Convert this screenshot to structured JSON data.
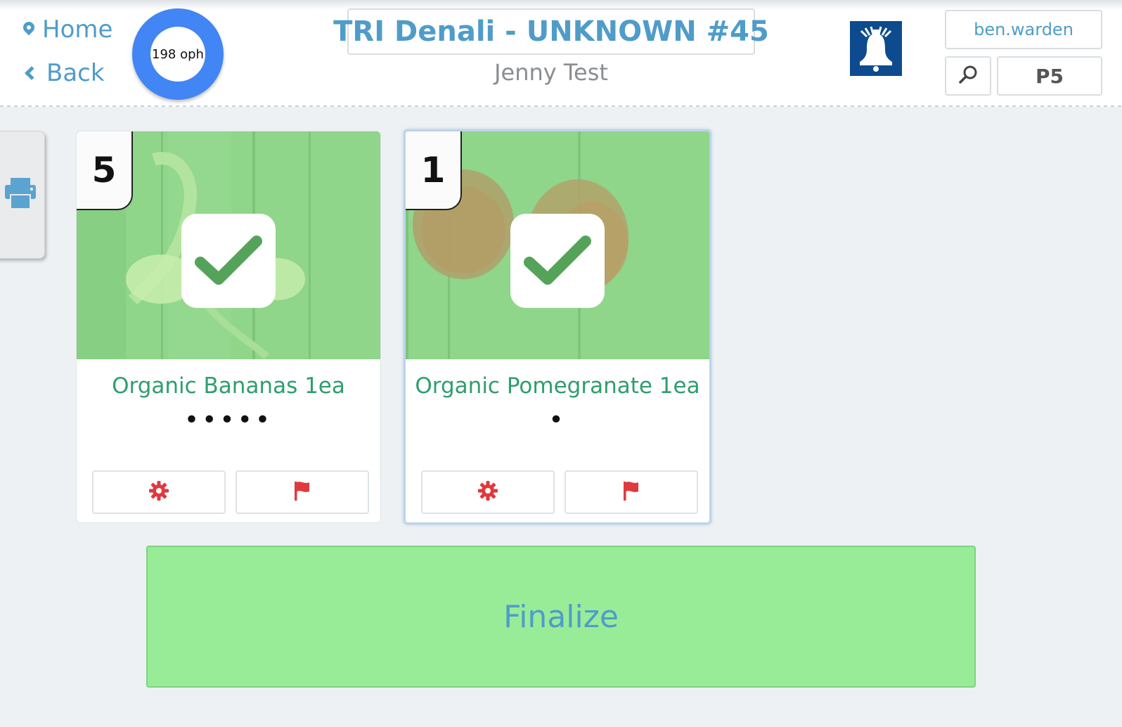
{
  "header": {
    "home_label": "Home",
    "back_label": "Back",
    "rate_text": "198 oph",
    "title": "TRI Denali - UNKNOWN #45",
    "subtitle": "Jenny Test",
    "username": "ben.warden",
    "p_label": "P5"
  },
  "cards": [
    {
      "quantity": "5",
      "name": "Organic Bananas 1ea",
      "dots": "•••••",
      "status": "checked",
      "image": "bananas",
      "selected": false
    },
    {
      "quantity": "1",
      "name": "Organic Pomegranate 1ea",
      "dots": "•",
      "status": "checked",
      "image": "pomegranates",
      "selected": true
    }
  ],
  "finalize_label": "Finalize",
  "icons": {
    "home": "map-pin-icon",
    "back": "chevron-left-icon",
    "search": "search-icon",
    "print": "printer-icon",
    "settings": "gear-icon",
    "flag": "flag-icon",
    "logo": "liberty-bell-icon",
    "check": "checkmark-icon"
  },
  "colors": {
    "accent": "#4f9cc9",
    "product_name": "#2e9e6c",
    "progress_ring": "#4285f4",
    "finalize_bg": "#98ec98",
    "danger_icon": "#e0393e",
    "logo_bg": "#0d4b8e"
  }
}
